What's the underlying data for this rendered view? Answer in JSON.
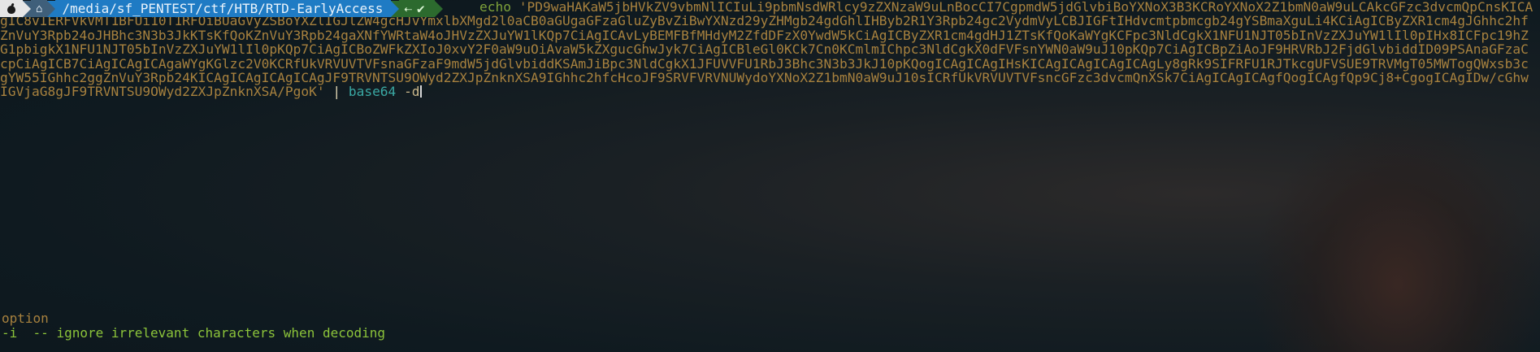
{
  "prompt": {
    "os_icon": "apple-icon",
    "home_icon": "home-icon",
    "home_symbol": "⌂",
    "path": "/media/sf_PENTEST/ctf/HTB/RTD-EarlyAccess",
    "git_branch_symbol": "⇠",
    "git_check": "✔"
  },
  "command": {
    "echo": "echo",
    "payload": "'PD9waHAKaW5jbHVkZV9vbmNlICIuLi9pbmNsdWRlcy9zZXNzaW9uLnBocCI7CgpmdW5jdGlvbiBoYXNoX3B3KCRoYXNoX2Z1bmN0aW9uLCAkcGFzc3dvcmQpCnsKICAgIC8vIERFVkVMT1BFUi10T1RFOiBUaGVyZSBoYXZlIGJlZW4gcHJvYmxlbXMgd2l0aCB0aGUgaGFzaGluZyBvZiBwYXNzd29yZHMgb24gdGhlIHByb2R1Y3Rpb24gc2VydmVyLCBJIGFtIHdvcmtpbmcgb24gYSBmaXguLi4KCiAgICByZXR1cm4gJGhhc2hfZnVuY3Rpb24oJHBhc3N3b3JkKTsKfQoKZnVuY3Rpb24gaXNfYWRtaW4oJHVzZXJuYW1lKQp7CiAgICAvLyBEMFBfMHdyM2ZfdDFzX0YwdW5kCiAgICByZXR1cm4gdHJ1ZTsKfQoKaWYgKCFpc3NldCgkX1NFU1NJT05bInVzZXJuYW1lIl0pIHx8ICFpc19hZG1pbigkX1NFU1NJT05bInVzZXJuYW1lIl0pKQp7CiAgICBoZWFkZXIoJ0xvY2F0aW9uOiAvaW5kZXgucGhwJyk7CiAgICBleGl0KCk7Cn0KCmlmIChpc3NldCgkX0dFVFsnYWN0aW9uJ10pKQp7CiAgICBpZiAoJF9HRVRbJ2FjdGlvbiddID09PSAnaGFzaCcpCiAgICB7CiAgICAgICAgaWYgKGlzc2V0KCRfUkVRVUVTVFsnaGFzaF9mdW5jdGlvbiddKSAmJiBpc3NldCgkX1JFUVVFU1RbJ3Bhc3N3b3JkJ10pKQogICAgICAgIHsKICAgICAgICAgICAgLy8gRk9SIFRFU1RJTkcgUFVSUE9TRVMgT05MWTogQWxsb3cgYW55IGhhc2ggZnVuY3Rpb24KICAgICAgICAgICAgJF9TRVNTSU9OWyd2ZXJpZnknXSA9IGhhc2hfcHcoJF9SRVFVRVNUWydoYXNoX2Z1bmN0aW9uJ10sICRfUkVRVUVTVFsncGFzc3dvcmQnXSk7CiAgICAgICAgfQogICAgfQp9Cj8+CgogICAgIDw/cGhwIGVjaG8gJF9TRVNTSU9OWyd2ZXJpZnknXSA/PgoK'",
    "pipe": "|",
    "decoder": "base64",
    "flag": "-d"
  },
  "completion": {
    "header": "option",
    "item_flag": "-i",
    "item_separator": "--",
    "item_description": "ignore irrelevant characters when decoding"
  },
  "colors": {
    "background": "#0d1a22",
    "payload": "#a7813e",
    "echo": "#7fa23a",
    "decoder": "#3aa8a3",
    "completion": "#8cc43a",
    "path_segment": "#1f7bc4",
    "git_segment": "#2c6a2e"
  }
}
